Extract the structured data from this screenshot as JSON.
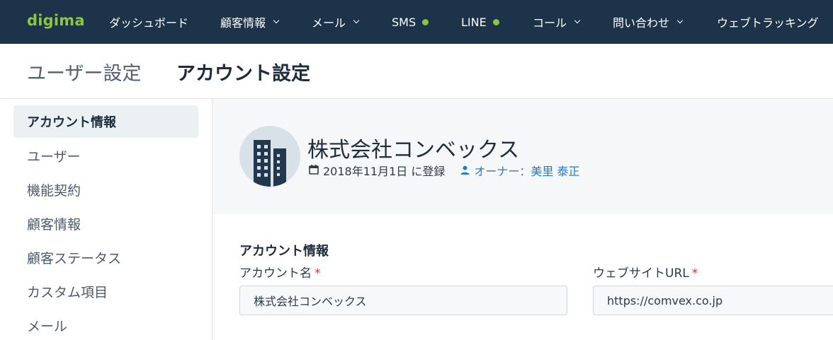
{
  "brand": {
    "logo_text": "digima",
    "nav_bg": "#1d3349",
    "accent_green": "#8cc63e",
    "link_blue": "#2a7ac0",
    "required_red": "#d9342b"
  },
  "topnav": {
    "items": [
      {
        "label": "ダッシュボード",
        "dropdown": false,
        "status_dot": false
      },
      {
        "label": "顧客情報",
        "dropdown": true,
        "status_dot": false
      },
      {
        "label": "メール",
        "dropdown": true,
        "status_dot": false
      },
      {
        "label": "SMS",
        "dropdown": false,
        "status_dot": true
      },
      {
        "label": "LINE",
        "dropdown": false,
        "status_dot": true
      },
      {
        "label": "コール",
        "dropdown": true,
        "status_dot": false
      },
      {
        "label": "問い合わせ",
        "dropdown": true,
        "status_dot": false
      },
      {
        "label": "ウェブトラッキング",
        "dropdown": false,
        "status_dot": false
      }
    ]
  },
  "header": {
    "breadcrumb_parent": "ユーザー設定",
    "page_title": "アカウント設定"
  },
  "sidebar": {
    "items": [
      {
        "label": "アカウント情報",
        "active": true
      },
      {
        "label": "ユーザー",
        "active": false
      },
      {
        "label": "機能契約",
        "active": false
      },
      {
        "label": "顧客情報",
        "active": false
      },
      {
        "label": "顧客ステータス",
        "active": false
      },
      {
        "label": "カスタム項目",
        "active": false
      },
      {
        "label": "メール",
        "active": false
      }
    ]
  },
  "profile": {
    "avatar_icon": "building-icon",
    "company_name": "株式会社コンベックス",
    "registered_icon": "calendar-icon",
    "registered_text": "2018年11月1日 に登録",
    "owner_icon": "user-icon",
    "owner_text": "オーナー：美里 泰正"
  },
  "form": {
    "section_title": "アカウント情報",
    "fields": [
      {
        "label": "アカウント名",
        "required_mark": "*",
        "value": "株式会社コンベックス"
      },
      {
        "label": "ウェブサイトURL",
        "required_mark": "*",
        "value": "https://comvex.co.jp"
      }
    ]
  }
}
